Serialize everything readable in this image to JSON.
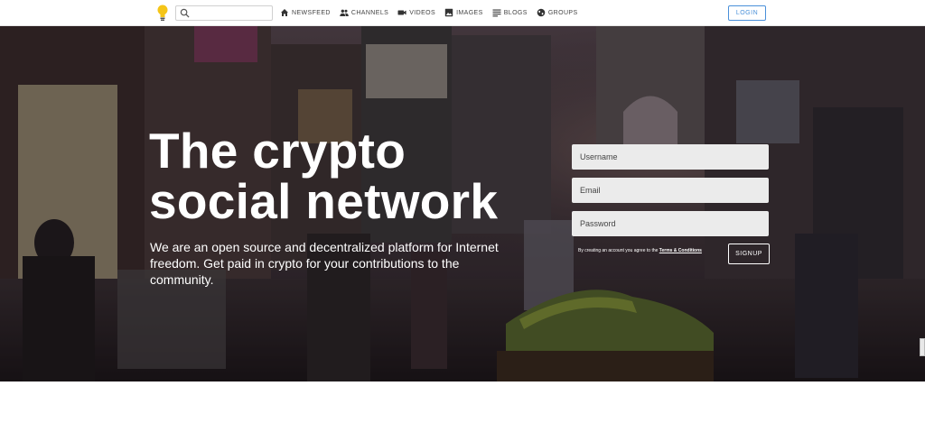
{
  "search": {
    "placeholder": "",
    "value": ""
  },
  "nav": [
    {
      "icon": "home-icon",
      "label": "NEWSFEED"
    },
    {
      "icon": "people-icon",
      "label": "CHANNELS"
    },
    {
      "icon": "video-camera-icon",
      "label": "VIDEOS"
    },
    {
      "icon": "image-icon",
      "label": "IMAGES"
    },
    {
      "icon": "blog-lines-icon",
      "label": "BLOGS"
    },
    {
      "icon": "globe-icon",
      "label": "GROUPS"
    }
  ],
  "header": {
    "login_label": "LOGIN"
  },
  "hero": {
    "headline_line1": "The crypto",
    "headline_line2": "social network",
    "subtitle": "We are an open source and decentralized platform for Internet freedom. Get paid in crypto for your contributions to the community."
  },
  "form": {
    "username_placeholder": "Username",
    "email_placeholder": "Email",
    "password_placeholder": "Password",
    "terms_prefix": "By creating an account you agree to the ",
    "terms_link": "Terms & Conditions",
    "signup_label": "SIGNUP"
  },
  "colors": {
    "accent": "#4a90d9",
    "field_bg": "#ebebeb",
    "hero_text": "#ffffff"
  }
}
